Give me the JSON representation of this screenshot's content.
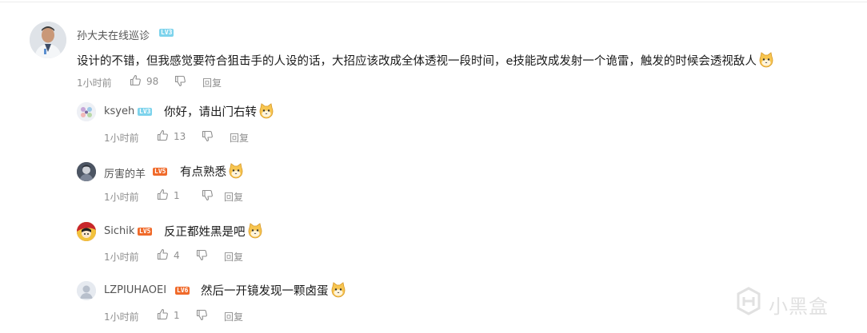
{
  "colors": {
    "accent_blue": "#7dd3ec",
    "accent_orange": "#f06a2a",
    "meta_gray": "#8f8f8f"
  },
  "main_comment": {
    "author": "孙大夫在线巡诊",
    "level": "LV3",
    "text": "设计的不错，但我感觉要符合狙击手的人设的话，大招应该改成全体透视一段时间，e技能改成发射一个诡雷，触发的时候会透视敌人",
    "emoji": "cat-face-emoji",
    "time": "1小时前",
    "likes": "98",
    "reply_label": "回复"
  },
  "replies": [
    {
      "author": "ksyeh",
      "level": "LV3",
      "text": "你好，请出门右转",
      "time": "1小时前",
      "likes": "13",
      "reply_label": "回复"
    },
    {
      "author": "厉害的羊",
      "level": "LV5",
      "text": "有点熟悉",
      "time": "1小时前",
      "likes": "1",
      "reply_label": "回复"
    },
    {
      "author": "Sichik",
      "level": "LV5",
      "text": "反正都姓黑是吧",
      "time": "1小时前",
      "likes": "4",
      "reply_label": "回复"
    },
    {
      "author": "LZPIUHAOEI",
      "level": "LV6",
      "text": "然后一开镜发现一颗卤蛋",
      "time": "1小时前",
      "likes": "1",
      "reply_label": "回复"
    }
  ],
  "watermark": {
    "text": "小黑盒",
    "icon": "heybox-logo-icon"
  }
}
